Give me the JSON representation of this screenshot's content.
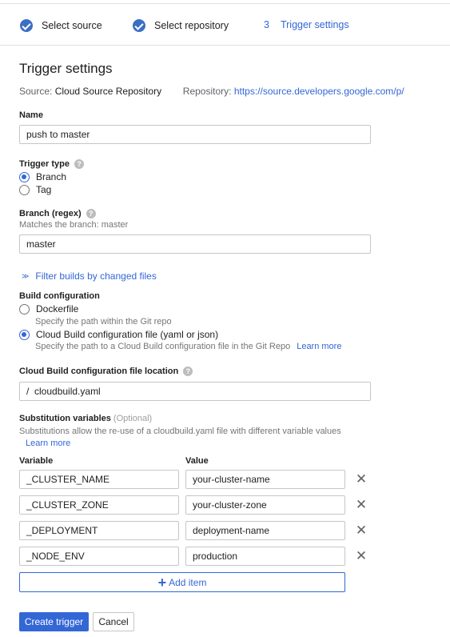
{
  "stepper": {
    "steps": [
      {
        "label": "Select source",
        "state": "done"
      },
      {
        "label": "Select repository",
        "state": "done"
      },
      {
        "number": "3",
        "label": "Trigger settings",
        "state": "active"
      }
    ]
  },
  "page": {
    "title": "Trigger settings",
    "source_label": "Source:",
    "source_value": "Cloud Source Repository",
    "repository_label": "Repository:",
    "repository_value": "https://source.developers.google.com/p/"
  },
  "name": {
    "label": "Name",
    "value": "push to master"
  },
  "trigger_type": {
    "label": "Trigger type",
    "options": [
      "Branch",
      "Tag"
    ],
    "selected": "Branch"
  },
  "branch": {
    "label": "Branch (regex)",
    "hint": "Matches the branch: master",
    "value": "master"
  },
  "filter_link": "Filter builds by changed files",
  "build_config": {
    "label": "Build configuration",
    "options": [
      {
        "label": "Dockerfile",
        "description": "Specify the path within the Git repo"
      },
      {
        "label": "Cloud Build configuration file (yaml or json)",
        "description": "Specify the path to a Cloud Build configuration file in the Git Repo",
        "link": "Learn more"
      }
    ],
    "selected": "Cloud Build configuration file (yaml or json)"
  },
  "config_location": {
    "label": "Cloud Build configuration file location",
    "prefix": "/",
    "value": "cloudbuild.yaml"
  },
  "substitutions": {
    "label": "Substitution variables",
    "optional": "(Optional)",
    "description": "Substitutions allow the re-use of a cloudbuild.yaml file with different variable values",
    "learn_more": "Learn more",
    "col_variable": "Variable",
    "col_value": "Value",
    "rows": [
      {
        "variable": "_CLUSTER_NAME",
        "value": "your-cluster-name"
      },
      {
        "variable": "_CLUSTER_ZONE",
        "value": "your-cluster-zone"
      },
      {
        "variable": "_DEPLOYMENT",
        "value": "deployment-name"
      },
      {
        "variable": "_NODE_ENV",
        "value": "production"
      }
    ],
    "add_item": "Add item"
  },
  "actions": {
    "create": "Create trigger",
    "cancel": "Cancel"
  },
  "colors": {
    "accent": "#3367d6",
    "check": "#3b6fc4"
  },
  "icons": {
    "done_step": "check-circle-icon",
    "help": "help-icon",
    "filter": "chevron-double-down-icon",
    "delete": "close-icon",
    "add": "plus-icon"
  }
}
